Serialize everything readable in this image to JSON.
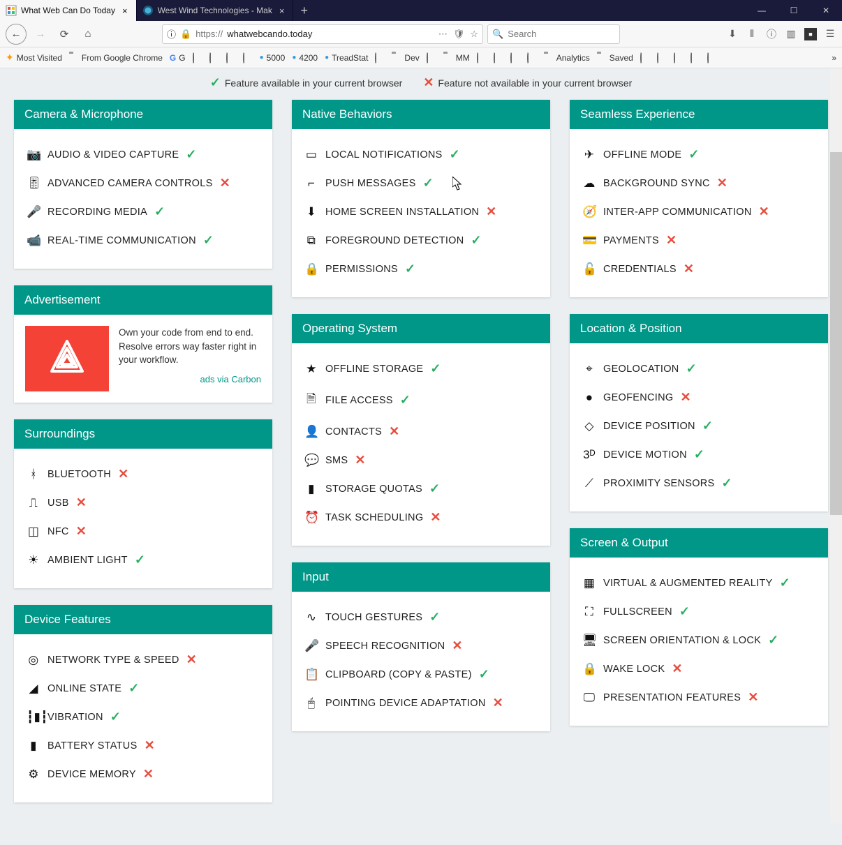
{
  "browser": {
    "tabs": [
      {
        "title": "What Web Can Do Today",
        "active": true
      },
      {
        "title": "West Wind Technologies - Mak",
        "active": false
      }
    ],
    "url_proto": "https://",
    "url_host": "whatwebcando.today",
    "search_placeholder": "Search",
    "bookmarks": [
      "Most Visited",
      "From Google Chrome",
      "G",
      "",
      "",
      "",
      "",
      "5000",
      "4200",
      "TreadStat",
      "",
      "Dev",
      "",
      "MM",
      "",
      "",
      "",
      "",
      "Analytics",
      "Saved",
      "",
      "",
      "",
      "",
      ""
    ]
  },
  "legend": {
    "available": "Feature available in your current browser",
    "not_available": "Feature not available in your current browser"
  },
  "columns": [
    [
      {
        "title": "Camera & Microphone",
        "type": "features",
        "items": [
          {
            "icon": "📷",
            "label": "AUDIO & VIDEO CAPTURE",
            "ok": true
          },
          {
            "icon": "🎚",
            "label": "ADVANCED CAMERA CONTROLS",
            "ok": false
          },
          {
            "icon": "🎤",
            "label": "RECORDING MEDIA",
            "ok": true
          },
          {
            "icon": "📹",
            "label": "REAL-TIME COMMUNICATION",
            "ok": true
          }
        ]
      },
      {
        "title": "Advertisement",
        "type": "ad",
        "ad": {
          "text": "Own your code from end to end. Resolve errors way faster right in your workflow.",
          "link": "ads via Carbon"
        }
      },
      {
        "title": "Surroundings",
        "type": "features",
        "items": [
          {
            "icon": "ᚼ",
            "label": "BLUETOOTH",
            "ok": false
          },
          {
            "icon": "⎍",
            "label": "USB",
            "ok": false
          },
          {
            "icon": "◫",
            "label": "NFC",
            "ok": false
          },
          {
            "icon": "☀",
            "label": "AMBIENT LIGHT",
            "ok": true
          }
        ]
      },
      {
        "title": "Device Features",
        "type": "features",
        "items": [
          {
            "icon": "◎",
            "label": "NETWORK TYPE & SPEED",
            "ok": false
          },
          {
            "icon": "◢",
            "label": "ONLINE STATE",
            "ok": true
          },
          {
            "icon": "┇▮┇",
            "label": "VIBRATION",
            "ok": true
          },
          {
            "icon": "▮",
            "label": "BATTERY STATUS",
            "ok": false
          },
          {
            "icon": "⚙",
            "label": "DEVICE MEMORY",
            "ok": false
          }
        ]
      }
    ],
    [
      {
        "title": "Native Behaviors",
        "type": "features",
        "items": [
          {
            "icon": "▭",
            "label": "LOCAL NOTIFICATIONS",
            "ok": true
          },
          {
            "icon": "⌐",
            "label": "PUSH MESSAGES",
            "ok": true
          },
          {
            "icon": "⬇",
            "label": "HOME SCREEN INSTALLATION",
            "ok": false
          },
          {
            "icon": "⧉",
            "label": "FOREGROUND DETECTION",
            "ok": true
          },
          {
            "icon": "🔒",
            "label": "PERMISSIONS",
            "ok": true
          }
        ]
      },
      {
        "title": "Operating System",
        "type": "features",
        "items": [
          {
            "icon": "★",
            "label": "OFFLINE STORAGE",
            "ok": true
          },
          {
            "icon": "🗎",
            "label": "FILE ACCESS",
            "ok": true
          },
          {
            "icon": "👤",
            "label": "CONTACTS",
            "ok": false
          },
          {
            "icon": "💬",
            "label": "SMS",
            "ok": false
          },
          {
            "icon": "▮",
            "label": "STORAGE QUOTAS",
            "ok": true
          },
          {
            "icon": "⏰",
            "label": "TASK SCHEDULING",
            "ok": false
          }
        ]
      },
      {
        "title": "Input",
        "type": "features",
        "items": [
          {
            "icon": "∿",
            "label": "TOUCH GESTURES",
            "ok": true
          },
          {
            "icon": "🎤",
            "label": "SPEECH RECOGNITION",
            "ok": false
          },
          {
            "icon": "📋",
            "label": "CLIPBOARD (COPY & PASTE)",
            "ok": true
          },
          {
            "icon": "🖱",
            "label": "POINTING DEVICE ADAPTATION",
            "ok": false
          }
        ]
      }
    ],
    [
      {
        "title": "Seamless Experience",
        "type": "features",
        "items": [
          {
            "icon": "✈",
            "label": "OFFLINE MODE",
            "ok": true
          },
          {
            "icon": "☁",
            "label": "BACKGROUND SYNC",
            "ok": false
          },
          {
            "icon": "🧭",
            "label": "INTER-APP COMMUNICATION",
            "ok": false
          },
          {
            "icon": "💳",
            "label": "PAYMENTS",
            "ok": false
          },
          {
            "icon": "🔓",
            "label": "CREDENTIALS",
            "ok": false
          }
        ]
      },
      {
        "title": "Location & Position",
        "type": "features",
        "items": [
          {
            "icon": "⌖",
            "label": "GEOLOCATION",
            "ok": true
          },
          {
            "icon": "●",
            "label": "GEOFENCING",
            "ok": false
          },
          {
            "icon": "◇",
            "label": "DEVICE POSITION",
            "ok": true
          },
          {
            "icon": "3ᴰ",
            "label": "DEVICE MOTION",
            "ok": true
          },
          {
            "icon": "⟋",
            "label": "PROXIMITY SENSORS",
            "ok": true
          }
        ]
      },
      {
        "title": "Screen & Output",
        "type": "features",
        "items": [
          {
            "icon": "▦",
            "label": "VIRTUAL & AUGMENTED REALITY",
            "ok": true
          },
          {
            "icon": "⛶",
            "label": "FULLSCREEN",
            "ok": true
          },
          {
            "icon": "🖥",
            "label": "SCREEN ORIENTATION & LOCK",
            "ok": true
          },
          {
            "icon": "🔒",
            "label": "WAKE LOCK",
            "ok": false
          },
          {
            "icon": "🖵",
            "label": "PRESENTATION FEATURES",
            "ok": false
          }
        ]
      }
    ]
  ]
}
